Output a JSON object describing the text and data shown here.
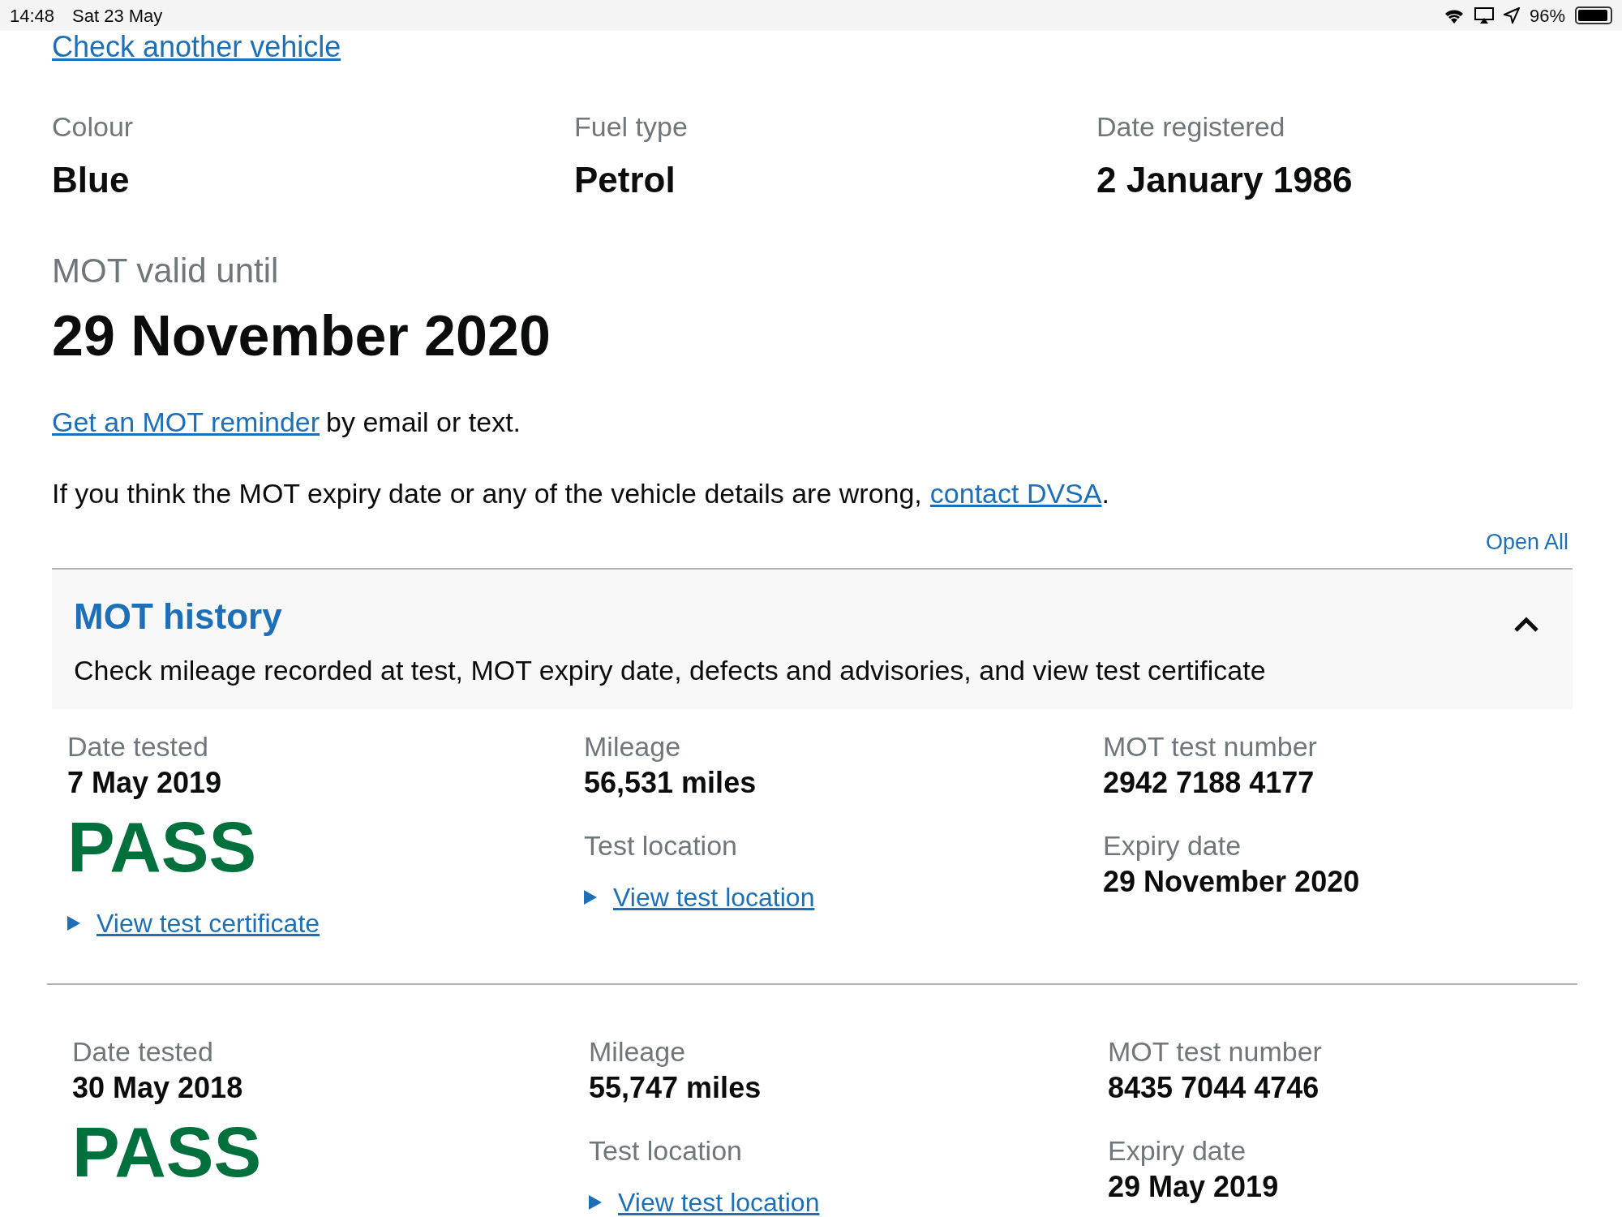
{
  "status_bar": {
    "time": "14:48",
    "date": "Sat 23 May",
    "battery": "96%"
  },
  "back_link": "Check another vehicle",
  "vehicle_details": [
    {
      "label": "Colour",
      "value": "Blue"
    },
    {
      "label": "Fuel type",
      "value": "Petrol"
    },
    {
      "label": "Date registered",
      "value": "2 January 1986"
    }
  ],
  "mot_valid": {
    "label": "MOT valid until",
    "date": "29 November 2020"
  },
  "reminder": {
    "link": "Get an MOT reminder",
    "text": "by email or text."
  },
  "contact": {
    "text": "If you think the MOT expiry date or any of the vehicle details are wrong,",
    "link": "contact DVSA",
    "end": "."
  },
  "open_all": "Open All",
  "accordion": {
    "title": "MOT history",
    "summary": "Check mileage recorded at test, MOT expiry date, defects and advisories, and view test certificate",
    "expanded": true,
    "tests": [
      {
        "date_label": "Date tested",
        "date": "7 May 2019",
        "result": "PASS",
        "certificate_link": "View test certificate",
        "mileage_label": "Mileage",
        "mileage": "56,531 miles",
        "location_label": "Test location",
        "location_link": "View test location",
        "number_label": "MOT test number",
        "number": "2942 7188 4177",
        "expiry_label": "Expiry date",
        "expiry": "29 November 2020"
      },
      {
        "date_label": "Date tested",
        "date": "30 May 2018",
        "result": "PASS",
        "mileage_label": "Mileage",
        "mileage": "55,747 miles",
        "location_label": "Test location",
        "location_link": "View test location",
        "number_label": "MOT test number",
        "number": "8435 7044 4746",
        "expiry_label": "Expiry date",
        "expiry": "29 May 2019"
      }
    ]
  }
}
